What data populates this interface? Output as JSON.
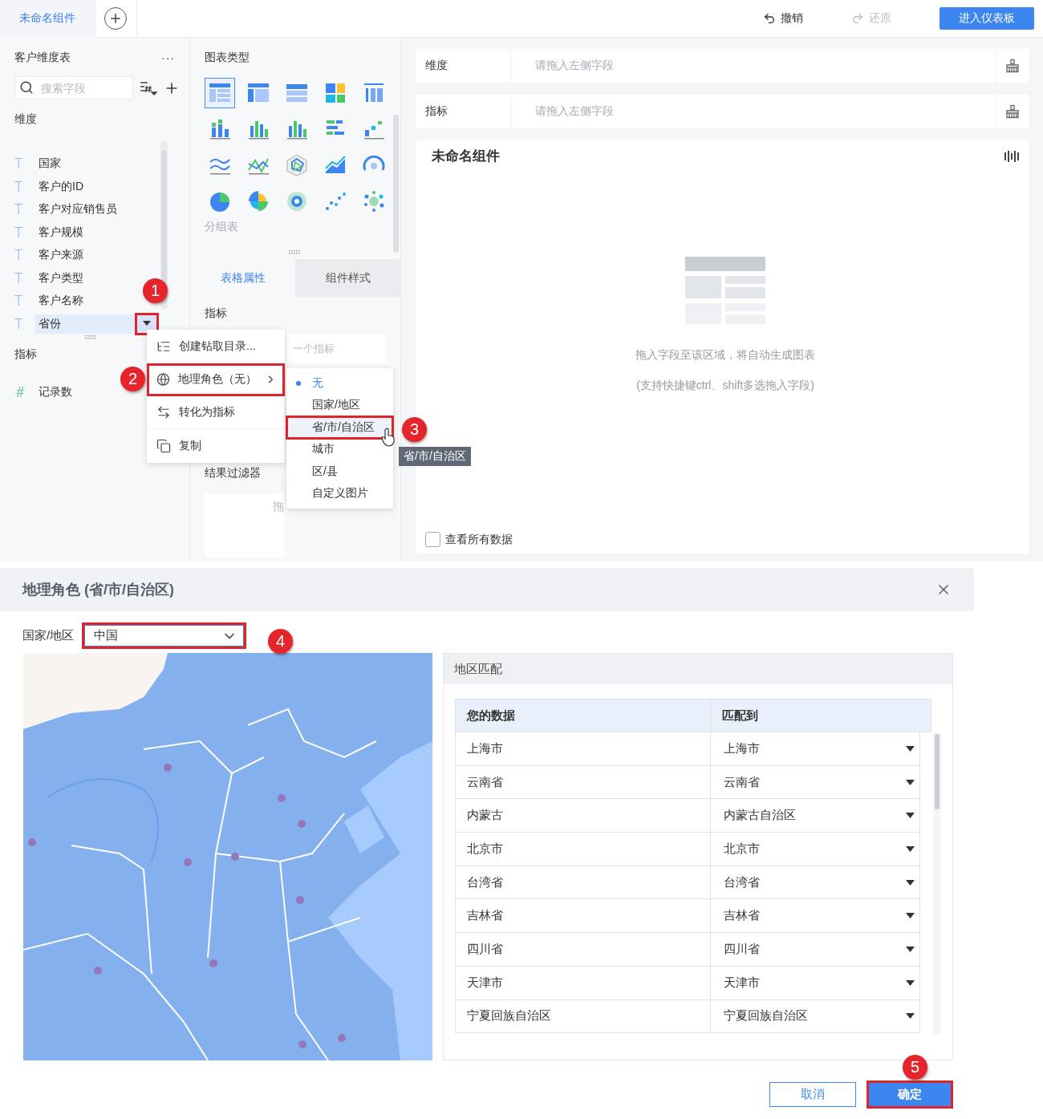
{
  "header": {
    "tab": "未命名组件",
    "undo": "撤销",
    "redo": "还原",
    "redo_disabled": true,
    "enter": "进入仪表板"
  },
  "data_panel": {
    "title": "客户维度表",
    "more": "···",
    "search_placeholder": "搜索字段",
    "dimension_label": "维度",
    "fields": [
      {
        "icon": "T",
        "name": "国家",
        "selected": false
      },
      {
        "icon": "T",
        "name": "客户的ID",
        "selected": false
      },
      {
        "icon": "T",
        "name": "客户对应销售员",
        "selected": false
      },
      {
        "icon": "T",
        "name": "客户规模",
        "selected": false
      },
      {
        "icon": "T",
        "name": "客户来源",
        "selected": false
      },
      {
        "icon": "T",
        "name": "客户类型",
        "selected": false
      },
      {
        "icon": "T",
        "name": "客户名称",
        "selected": false
      },
      {
        "icon": "T",
        "name": "省份",
        "selected": true
      }
    ],
    "dropdown_highlighted": true,
    "measure_label": "指标",
    "measures": [
      {
        "icon": "#",
        "name": "记录数"
      }
    ]
  },
  "chart_panel": {
    "title": "图表类型",
    "types": [
      {
        "kind": "table",
        "selected": true
      },
      {
        "kind": "crosstab",
        "selected": false
      },
      {
        "kind": "grid",
        "selected": false
      },
      {
        "kind": "treemap",
        "selected": false
      },
      {
        "kind": "number",
        "selected": false
      },
      {
        "kind": "stacked",
        "selected": false
      },
      {
        "kind": "bars",
        "selected": false
      },
      {
        "kind": "bars",
        "selected": false
      },
      {
        "kind": "hbars",
        "selected": false
      },
      {
        "kind": "steps",
        "selected": false
      },
      {
        "kind": "lines",
        "selected": false
      },
      {
        "kind": "line",
        "selected": false
      },
      {
        "kind": "radar",
        "selected": false
      },
      {
        "kind": "area",
        "selected": false
      },
      {
        "kind": "gauge",
        "selected": false
      },
      {
        "kind": "pie",
        "selected": false
      },
      {
        "kind": "rose",
        "selected": false
      },
      {
        "kind": "ring",
        "selected": false
      },
      {
        "kind": "scatter",
        "selected": false
      },
      {
        "kind": "bubble",
        "selected": false
      }
    ],
    "type_hint": "分组表",
    "tabs": [
      {
        "label": "表格属性",
        "selected": true
      },
      {
        "label": "组件样式",
        "selected": false
      }
    ],
    "measure_section": "指标",
    "measure_drop": "一个指标",
    "filter_label": "结果过滤器",
    "filter_drop": "拖"
  },
  "builder": {
    "rows": [
      {
        "label": "维度",
        "placeholder": "请拖入左侧字段"
      },
      {
        "label": "指标",
        "placeholder": "请拖入左侧字段"
      }
    ],
    "widget_title": "未命名组件",
    "empty_hint": "拖入字段至该区域，将自动生成图表",
    "empty_sub": "(支持快捷键ctrl、shift多选拖入字段)",
    "show_all": {
      "label": "查看所有数据",
      "checked": false
    }
  },
  "context_menu": [
    {
      "kind": "tree",
      "label": "创建钻取目录...",
      "submenu": false,
      "highlighted": false
    },
    {
      "kind": "globe",
      "label": "地理角色（无）",
      "submenu": true,
      "highlighted": true
    },
    {
      "kind": "swap",
      "label": "转化为指标",
      "submenu": false,
      "highlighted": false
    },
    {
      "kind": "copy",
      "label": "复制",
      "submenu": false,
      "highlighted": false
    }
  ],
  "submenu": [
    {
      "label": "无",
      "selected": true,
      "hovered": false,
      "highlighted": false
    },
    {
      "label": "国家/地区",
      "selected": false,
      "hovered": false,
      "highlighted": false
    },
    {
      "label": "省/市/自治区",
      "selected": false,
      "hovered": true,
      "highlighted": true
    },
    {
      "label": "城市",
      "selected": false,
      "hovered": false,
      "highlighted": false
    },
    {
      "label": "区/县",
      "selected": false,
      "hovered": false,
      "highlighted": false
    },
    {
      "label": "自定义图片",
      "selected": false,
      "hovered": false,
      "highlighted": false
    }
  ],
  "tooltip": "省/市/自治区",
  "dialog": {
    "title": "地理角色 (省/市/自治区)",
    "country_label": "国家/地区",
    "country_value": "中国",
    "country_highlighted": true,
    "match_title": "地区匹配",
    "columns": [
      "您的数据",
      "匹配到"
    ],
    "rows": [
      [
        "上海市",
        "上海市"
      ],
      [
        "云南省",
        "云南省"
      ],
      [
        "内蒙古",
        "内蒙古自治区"
      ],
      [
        "北京市",
        "北京市"
      ],
      [
        "台湾省",
        "台湾省"
      ],
      [
        "吉林省",
        "吉林省"
      ],
      [
        "四川省",
        "四川省"
      ],
      [
        "天津市",
        "天津市"
      ],
      [
        "宁夏回族自治区",
        "宁夏回族自治区"
      ]
    ],
    "cancel": "取消",
    "confirm": "确定",
    "confirm_highlighted": true
  },
  "callouts": [
    "1",
    "2",
    "3",
    "4",
    "5"
  ]
}
